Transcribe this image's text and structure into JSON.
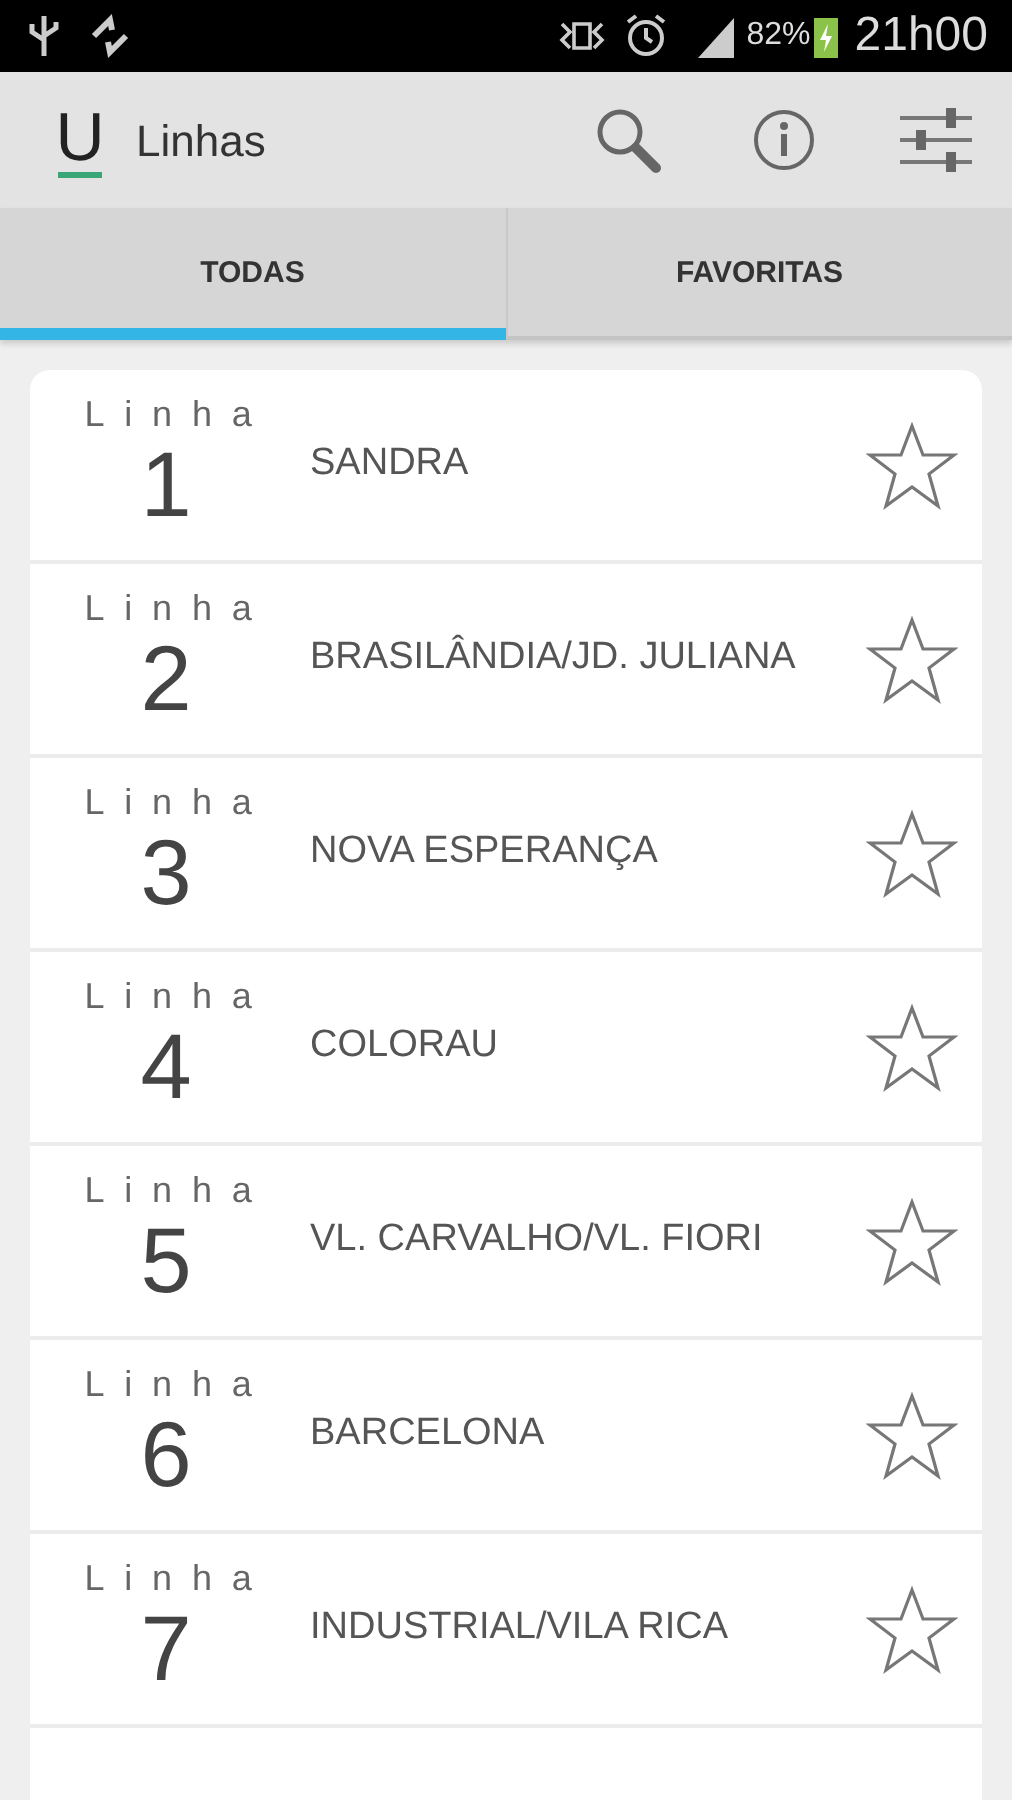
{
  "status_bar": {
    "battery": "82%",
    "time": "21h00"
  },
  "app_bar": {
    "logo": "U",
    "title": "Linhas"
  },
  "tabs": [
    {
      "label": "TODAS",
      "selected": true
    },
    {
      "label": "FAVORITAS",
      "selected": false
    }
  ],
  "lines": [
    {
      "label": "Linha",
      "number": "1",
      "name": "SANDRA",
      "favorite": false
    },
    {
      "label": "Linha",
      "number": "2",
      "name": "BRASILÂNDIA/JD. JULIANA",
      "favorite": false
    },
    {
      "label": "Linha",
      "number": "3",
      "name": "NOVA ESPERANÇA",
      "favorite": false
    },
    {
      "label": "Linha",
      "number": "4",
      "name": "COLORAU",
      "favorite": false
    },
    {
      "label": "Linha",
      "number": "5",
      "name": "VL. CARVALHO/VL. FIORI",
      "favorite": false
    },
    {
      "label": "Linha",
      "number": "6",
      "name": "BARCELONA",
      "favorite": false
    },
    {
      "label": "Linha",
      "number": "7",
      "name": "INDUSTRIAL/VILA RICA",
      "favorite": false
    }
  ]
}
